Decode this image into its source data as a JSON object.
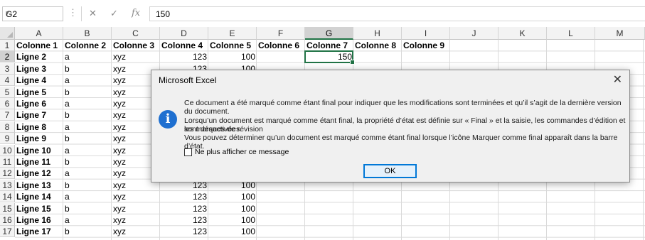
{
  "formula_bar": {
    "name_box": "G2",
    "name_box_arrow": "▾",
    "separator_dots": "⋮",
    "cancel_icon": "✕",
    "enter_icon": "✓",
    "fx_label": "fx",
    "value": "150"
  },
  "columns": [
    "A",
    "B",
    "C",
    "D",
    "E",
    "F",
    "G",
    "H",
    "I",
    "J",
    "K",
    "L",
    "M"
  ],
  "selected_column": "G",
  "rows": [
    "1",
    "2",
    "3",
    "4",
    "5",
    "6",
    "7",
    "8",
    "9",
    "10",
    "11",
    "12",
    "13",
    "14",
    "15",
    "16",
    "17"
  ],
  "selected_row": "2",
  "header_row": [
    "Colonne 1",
    "Colonne 2",
    "Colonne 3",
    "Colonne 4",
    "Colonne 5",
    "Colonne 6",
    "Colonne 7",
    "Colonne 8",
    "Colonne 9"
  ],
  "data_rows": [
    {
      "label": "Ligne 2",
      "b": "a",
      "c": "xyz",
      "d": "123",
      "e": "100",
      "g": "150"
    },
    {
      "label": "Ligne 3",
      "b": "b",
      "c": "xyz",
      "d": "123",
      "e": "100"
    },
    {
      "label": "Ligne 4",
      "b": "a",
      "c": "xyz"
    },
    {
      "label": "Ligne 5",
      "b": "b",
      "c": "xyz"
    },
    {
      "label": "Ligne 6",
      "b": "a",
      "c": "xyz"
    },
    {
      "label": "Ligne 7",
      "b": "b",
      "c": "xyz"
    },
    {
      "label": "Ligne 8",
      "b": "a",
      "c": "xyz"
    },
    {
      "label": "Ligne 9",
      "b": "b",
      "c": "xyz"
    },
    {
      "label": "Ligne 10",
      "b": "a",
      "c": "xyz"
    },
    {
      "label": "Ligne 11",
      "b": "b",
      "c": "xyz"
    },
    {
      "label": "Ligne 12",
      "b": "a",
      "c": "xyz"
    },
    {
      "label": "Ligne 13",
      "b": "b",
      "c": "xyz",
      "d": "123",
      "e": "100"
    },
    {
      "label": "Ligne 14",
      "b": "a",
      "c": "xyz",
      "d": "123",
      "e": "100"
    },
    {
      "label": "Ligne 15",
      "b": "b",
      "c": "xyz",
      "d": "123",
      "e": "100"
    },
    {
      "label": "Ligne 16",
      "b": "a",
      "c": "xyz",
      "d": "123",
      "e": "100"
    },
    {
      "label": "Ligne 17",
      "b": "b",
      "c": "xyz",
      "d": "123",
      "e": "100"
    }
  ],
  "dialog": {
    "title": "Microsoft Excel",
    "close_glyph": "✕",
    "icon": "info-icon",
    "icon_glyph": "i",
    "line1": "Ce document a été marqué comme étant final pour indiquer que les modifications sont terminées et qu’il s’agit de la dernière version du document.",
    "line2": "Lorsqu’un document est marqué comme étant final, la propriété d’état est définie sur « Final » et la saisie, les commandes d’édition et les marques de révision",
    "line3": "sont désactivées.",
    "line4": "Vous pouvez déterminer qu’un document est marqué comme étant final lorsque l’icône Marquer comme final apparaît dans la barre d’état.",
    "checkbox_label": "Ne plus afficher ce message",
    "ok_label": "OK"
  },
  "colors": {
    "accent": "#217346",
    "info_blue": "#1e6fd0",
    "button_border": "#0078d7"
  }
}
